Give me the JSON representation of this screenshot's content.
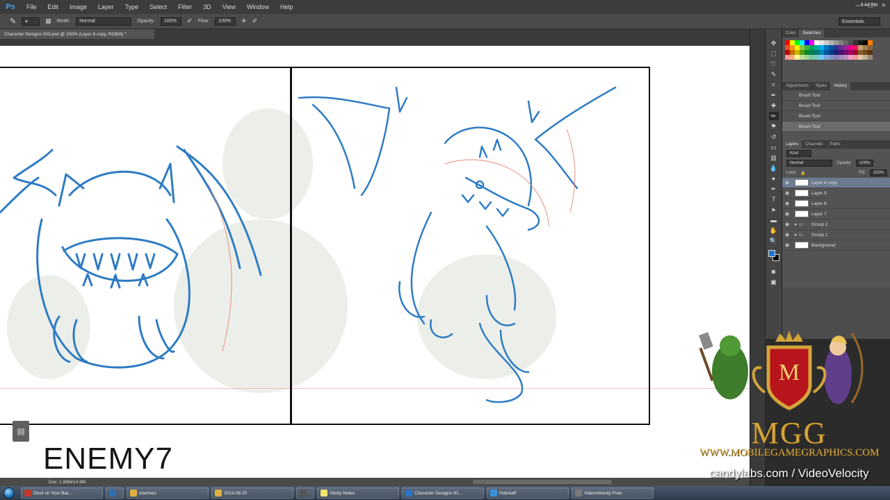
{
  "app": {
    "logo": "Ps",
    "menu": [
      "File",
      "Edit",
      "Image",
      "Layer",
      "Type",
      "Select",
      "Filter",
      "3D",
      "View",
      "Window",
      "Help"
    ],
    "window_controls": [
      "–",
      "□",
      "×"
    ]
  },
  "options_bar": {
    "mode_label": "Mode:",
    "mode_value": "Normal",
    "opacity_label": "Opacity:",
    "opacity_value": "100%",
    "flow_label": "Flow:",
    "flow_value": "100%",
    "workspace": "Essentials"
  },
  "document": {
    "tab_title": "Character Designs 003.psd @ 200% (Layer 8 copy, RGB/8) *"
  },
  "canvas": {
    "label": "ENEMY7"
  },
  "status": {
    "doc_info": "Doc: 1.88M/14.9M"
  },
  "panels": {
    "top_tabs": [
      "Color",
      "Swatches"
    ],
    "mid_tabs": [
      "Adjustments",
      "Styles",
      "History"
    ],
    "history_items": [
      "Brush Tool",
      "Brush Tool",
      "Brush Tool",
      "Brush Tool"
    ],
    "layer_tabs": [
      "Layers",
      "Channels",
      "Paths"
    ],
    "layer_kind": "Kind",
    "blend_mode": "Normal",
    "opacity_label": "Opacity:",
    "opacity_value": "100%",
    "lock_label": "Lock:",
    "fill_label": "Fill:",
    "fill_value": "100%",
    "layers": [
      {
        "name": "Layer 8 copy",
        "type": "layer",
        "active": true
      },
      {
        "name": "Layer 9",
        "type": "layer",
        "active": false
      },
      {
        "name": "Layer 8",
        "type": "layer",
        "active": false
      },
      {
        "name": "Layer 7",
        "type": "layer",
        "active": false
      },
      {
        "name": "Group 2",
        "type": "group",
        "active": false
      },
      {
        "name": "Group 1",
        "type": "group",
        "active": false
      },
      {
        "name": "Background",
        "type": "layer",
        "active": false
      }
    ],
    "swatch_colors": [
      "#ff0000",
      "#ffff00",
      "#00ff00",
      "#00ffff",
      "#0000ff",
      "#ff00ff",
      "#ffffff",
      "#e6e6e6",
      "#cccccc",
      "#b3b3b3",
      "#999999",
      "#808080",
      "#666666",
      "#4d4d4d",
      "#333333",
      "#1a1a1a",
      "#000000",
      "#ff7f00",
      "#f04e23",
      "#f7941d",
      "#fff200",
      "#8dc63f",
      "#39b54a",
      "#00a651",
      "#00a99d",
      "#00aeef",
      "#0072bc",
      "#0054a6",
      "#2e3192",
      "#662d91",
      "#92278f",
      "#ec008c",
      "#ed145b",
      "#c69c6d",
      "#a67c52",
      "#8c6239",
      "#c2000b",
      "#c36f00",
      "#c8b900",
      "#5a9a00",
      "#008b2a",
      "#007d4f",
      "#007b74",
      "#0083b3",
      "#0058a3",
      "#003a86",
      "#1d1d75",
      "#470e75",
      "#6b0a6f",
      "#a40062",
      "#a20030",
      "#8a5a2b",
      "#70471d",
      "#5a3410",
      "#f6989d",
      "#fbad82",
      "#fff799",
      "#c4df9b",
      "#a3d39c",
      "#82ca9c",
      "#7accc8",
      "#6dcff6",
      "#7da7d9",
      "#8393ca",
      "#8781bd",
      "#a187be",
      "#bd8cbf",
      "#f49ac2",
      "#f6989d",
      "#e2caa8",
      "#c7b299",
      "#998675"
    ]
  },
  "watermark": {
    "brand": "MGG",
    "url": "WWW.MOBILEGAMEGRAPHICS.COM",
    "emblem_letter": "M",
    "credit": "candylabs.com / VideoVelocity"
  },
  "taskbar": {
    "items": [
      {
        "label": "Devil on Your Bac...",
        "color": "#c0392b"
      },
      {
        "label": "",
        "color": "#2c6fb5"
      },
      {
        "label": "enemies",
        "color": "#e0b040"
      },
      {
        "label": "2013-08-25",
        "color": "#e0b040"
      },
      {
        "label": "",
        "color": "#555555"
      },
      {
        "label": "Sticky Notes",
        "color": "#f2e36b"
      },
      {
        "label": "Character Designs 00...",
        "color": "#2a73c6"
      },
      {
        "label": "Hubstaff",
        "color": "#3a8fd9"
      },
      {
        "label": "VideoVelocity Free",
        "color": "#7a7a7a"
      }
    ],
    "clock": "9:44 PM"
  },
  "colors": {
    "sketch_blue": "#2e7bc4",
    "guide_red": "#e48a7a",
    "brand_gold": "#d4a53a"
  }
}
